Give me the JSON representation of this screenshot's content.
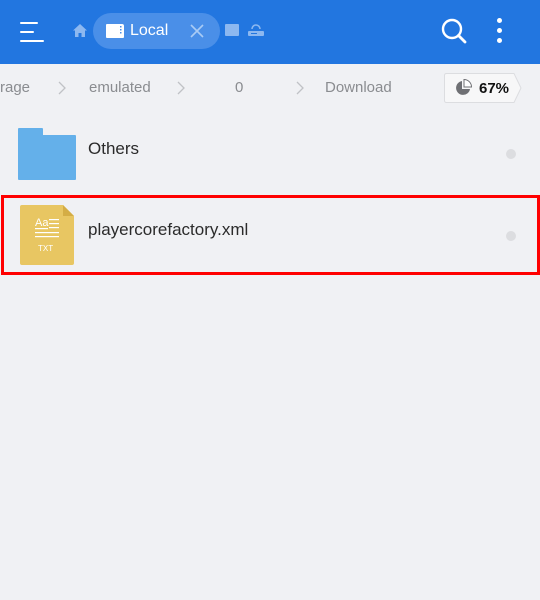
{
  "topbar": {
    "background": "#2276e0",
    "menu_icon": "hamburger-menu-icon",
    "home_icon": "home-icon",
    "active_tab": {
      "label": "Local",
      "icon": "sd-card-icon",
      "close_icon": "close-icon"
    },
    "other_tabs": [
      {
        "icon": "sd-card-icon"
      },
      {
        "icon": "network-router-icon"
      }
    ],
    "search_icon": "search-icon",
    "more_icon": "more-vertical-icon"
  },
  "breadcrumb": {
    "items": [
      "rage",
      "emulated",
      "0",
      "Download"
    ],
    "separator_icon": "chevron-right-icon"
  },
  "storage": {
    "used_percent": 67,
    "label": "67%",
    "icon": "pie-chart-icon"
  },
  "files": [
    {
      "name": "Others",
      "type": "folder",
      "icon": "folder-icon",
      "color": "#64b0ea"
    },
    {
      "name": "playercorefactory.xml",
      "type": "txt",
      "icon": "txt-file-icon",
      "icon_label": "TXT",
      "icon_text": "Aa",
      "color": "#e8c662",
      "highlighted": true
    }
  ],
  "highlight_color": "#ff0000"
}
